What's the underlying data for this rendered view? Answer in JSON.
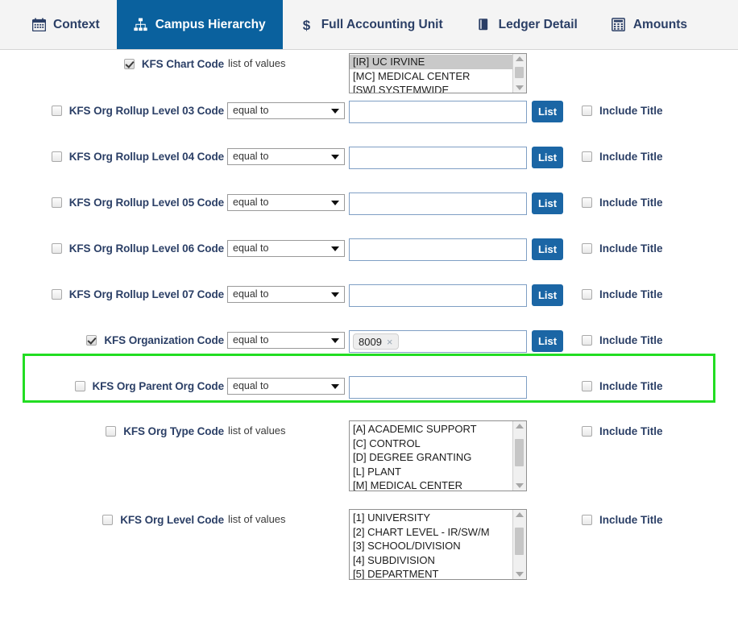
{
  "tabs": [
    {
      "label": "Context",
      "icon": "calendar-icon",
      "active": false
    },
    {
      "label": "Campus Hierarchy",
      "icon": "sitemap-icon",
      "active": true
    },
    {
      "label": "Full Accounting Unit",
      "icon": "dollar-icon",
      "active": false
    },
    {
      "label": "Ledger Detail",
      "icon": "book-icon",
      "active": false
    },
    {
      "label": "Amounts",
      "icon": "calculator-icon",
      "active": false
    }
  ],
  "colors": {
    "active_tab_bg": "#0a619e",
    "list_button_bg": "#1b66a5",
    "label_text": "#2b3f66",
    "highlight_border": "#22dd22",
    "tabbar_bg": "#f4f4f4"
  },
  "common": {
    "list_button_label": "List",
    "include_title_label": "Include Title",
    "list_of_values_label": "list of values",
    "operator_equal_to": "equal to",
    "chip_remove_label": "×"
  },
  "rows": [
    {
      "name": "kfs-chart-code",
      "label": "KFS Chart Code",
      "checked": true,
      "control": "listbox",
      "lov_label": "list of values",
      "options": [
        {
          "text": "[IR] UC IRVINE",
          "selected": true
        },
        {
          "text": "[MC] MEDICAL CENTER",
          "selected": false
        },
        {
          "text": "[SW] SYSTEMWIDE",
          "selected": false
        }
      ],
      "include_title": null,
      "list_button": false
    },
    {
      "name": "kfs-org-rollup-level-03-code",
      "label": "KFS Org Rollup Level 03 Code",
      "checked": false,
      "control": "input",
      "operator": "equal to",
      "value": "",
      "chip": null,
      "list_button": true,
      "include_title": {
        "label": "Include Title",
        "checked": false
      }
    },
    {
      "name": "kfs-org-rollup-level-04-code",
      "label": "KFS Org Rollup Level 04 Code",
      "checked": false,
      "control": "input",
      "operator": "equal to",
      "value": "",
      "chip": null,
      "list_button": true,
      "include_title": {
        "label": "Include Title",
        "checked": false
      }
    },
    {
      "name": "kfs-org-rollup-level-05-code",
      "label": "KFS Org Rollup Level 05 Code",
      "checked": false,
      "control": "input",
      "operator": "equal to",
      "value": "",
      "chip": null,
      "list_button": true,
      "include_title": {
        "label": "Include Title",
        "checked": false
      }
    },
    {
      "name": "kfs-org-rollup-level-06-code",
      "label": "KFS Org Rollup Level 06 Code",
      "checked": false,
      "control": "input",
      "operator": "equal to",
      "value": "",
      "chip": null,
      "list_button": true,
      "include_title": {
        "label": "Include Title",
        "checked": false
      }
    },
    {
      "name": "kfs-org-rollup-level-07-code",
      "label": "KFS Org Rollup Level 07 Code",
      "checked": false,
      "control": "input",
      "operator": "equal to",
      "value": "",
      "chip": null,
      "list_button": true,
      "include_title": {
        "label": "Include Title",
        "checked": false
      }
    },
    {
      "name": "kfs-organization-code",
      "label": "KFS Organization Code",
      "checked": true,
      "highlighted": true,
      "control": "input",
      "operator": "equal to",
      "value": "",
      "chip": "8009",
      "list_button": true,
      "include_title": {
        "label": "Include Title",
        "checked": false
      }
    },
    {
      "name": "kfs-org-parent-org-code",
      "label": "KFS Org Parent Org Code",
      "checked": false,
      "control": "input",
      "operator": "equal to",
      "value": "",
      "chip": null,
      "list_button": false,
      "include_title": {
        "label": "Include Title",
        "checked": false
      }
    },
    {
      "name": "kfs-org-type-code",
      "label": "KFS Org Type Code",
      "checked": false,
      "control": "listbox",
      "lov_label": "list of values",
      "options": [
        {
          "text": "[A] ACADEMIC SUPPORT",
          "selected": false
        },
        {
          "text": "[C] CONTROL",
          "selected": false
        },
        {
          "text": "[D] DEGREE GRANTING",
          "selected": false
        },
        {
          "text": "[L] PLANT",
          "selected": false
        },
        {
          "text": "[M] MEDICAL CENTER",
          "selected": false
        }
      ],
      "include_title": {
        "label": "Include Title",
        "checked": false
      },
      "list_button": false
    },
    {
      "name": "kfs-org-level-code",
      "label": "KFS Org Level Code",
      "checked": false,
      "control": "listbox",
      "lov_label": "list of values",
      "options": [
        {
          "text": "[1] UNIVERSITY",
          "selected": false
        },
        {
          "text": "[2] CHART LEVEL - IR/SW/M",
          "selected": false
        },
        {
          "text": "[3] SCHOOL/DIVISION",
          "selected": false
        },
        {
          "text": "[4] SUBDIVISION",
          "selected": false
        },
        {
          "text": "[5] DEPARTMENT",
          "selected": false
        }
      ],
      "include_title": {
        "label": "Include Title",
        "checked": false
      },
      "list_button": false
    }
  ]
}
